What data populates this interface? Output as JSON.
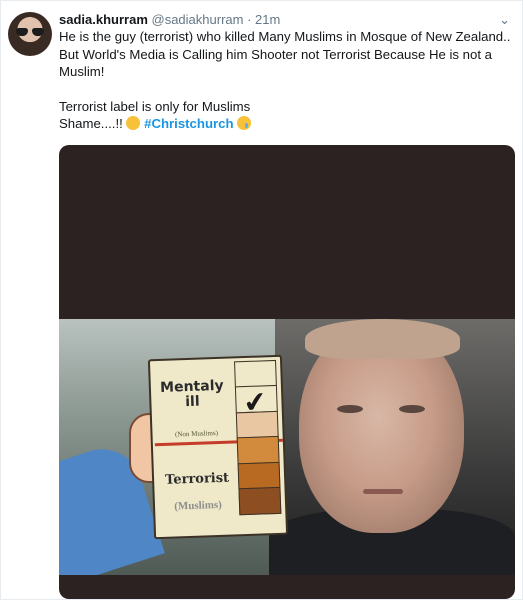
{
  "tweet": {
    "name": "sadia.khurram",
    "handle": "@sadiakhurram",
    "separator": "·",
    "time": "21m",
    "more_icon": "chevron-down-icon",
    "line1": "He is the guy (terrorist) who killed Many Muslims in Mosque of New Zealand..",
    "line2": "But World's Media is Calling him Shooter not Terrorist Because He is not a",
    "line3": "Muslim!",
    "line4": "Terrorist label is only for Muslims",
    "line5_text": "Shame....!!",
    "hashtag": "#Christchurch",
    "emoji1": "confounded-face-emoji",
    "emoji2": "crying-face-emoji"
  },
  "meme": {
    "label_top": "Mentaly ill",
    "label_small": "(Non Muslims)",
    "label_mid": "Terrorist",
    "label_bottom": "(Muslims)",
    "check_mark": "✔"
  }
}
